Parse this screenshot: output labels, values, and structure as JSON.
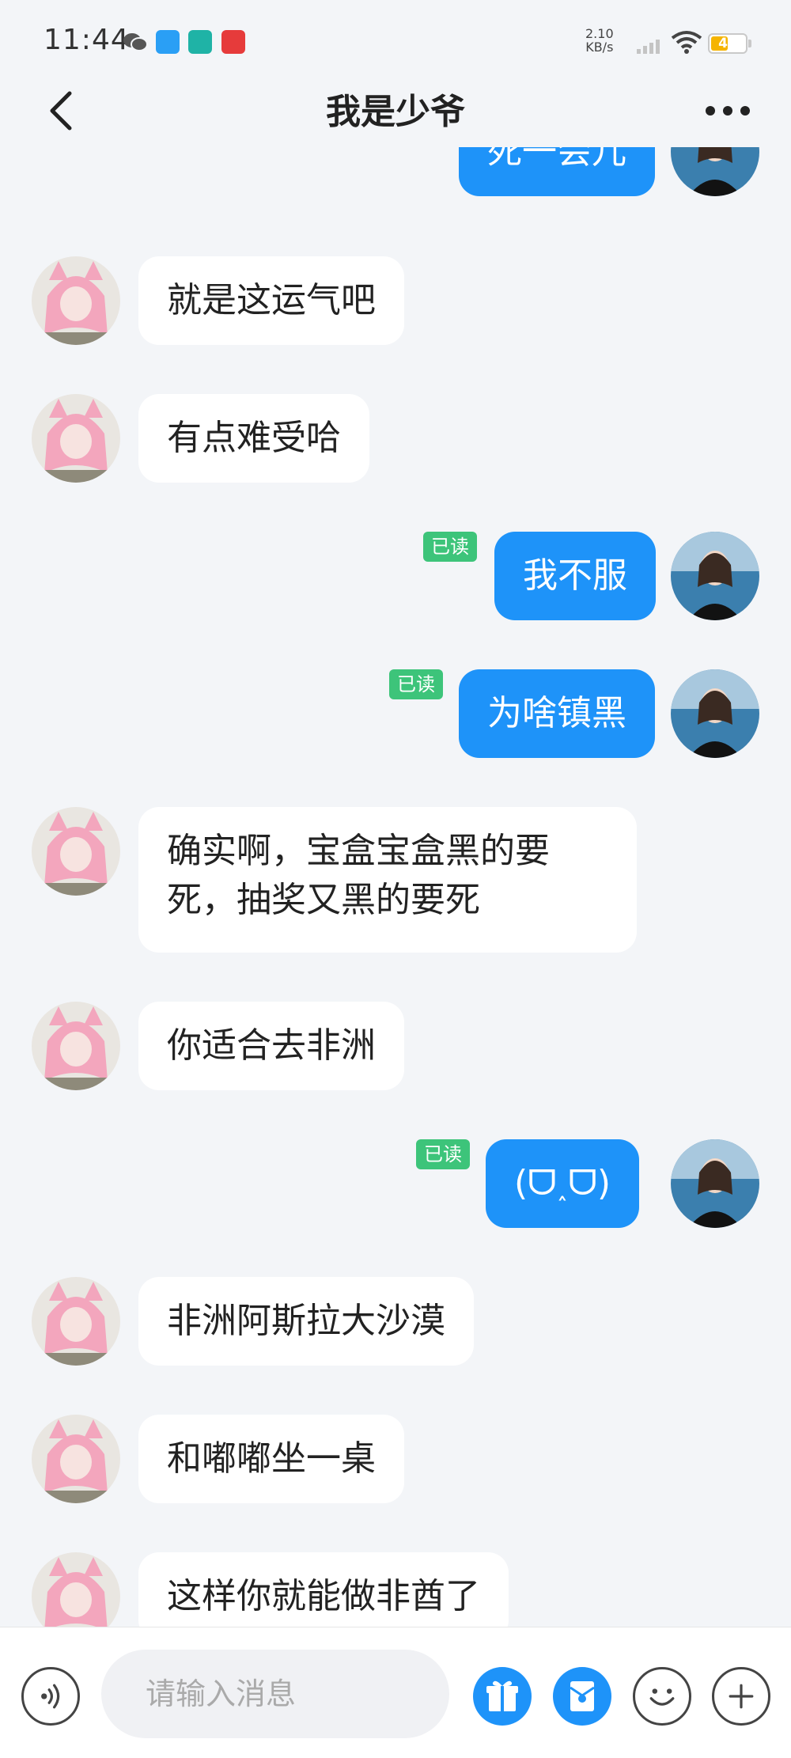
{
  "status_bar": {
    "time": "11:44",
    "net_speed_value": "2.10",
    "net_speed_unit": "KB/s",
    "battery_percent": 49,
    "battery_color": "#f5b400",
    "icons": [
      "wechat-icon",
      "app-blue-icon",
      "boss-app-icon",
      "red-app-icon",
      "signal-icon",
      "wifi-icon",
      "battery-icon"
    ]
  },
  "header": {
    "title": "我是少爷",
    "back_icon": "chevron-left-icon",
    "more_icon": "more-dots-icon"
  },
  "messages": [
    {
      "side": "out",
      "text": "死一会儿",
      "read": ""
    },
    {
      "side": "in",
      "text": "就是这运气吧"
    },
    {
      "side": "in",
      "text": "有点难受哈"
    },
    {
      "side": "out",
      "text": "我不服",
      "read": "已读"
    },
    {
      "side": "out",
      "text": "为啥镇黑",
      "read": "已读"
    },
    {
      "side": "in",
      "text_line1": "确实啊，宝盒宝盒黑的要",
      "text_line2": "死，抽奖又黑的要死"
    },
    {
      "side": "in",
      "text": "你适合去非洲"
    },
    {
      "side": "out",
      "text": "(ᗜ˰ᗜ)",
      "read": "已读"
    },
    {
      "side": "in",
      "text": "非洲阿斯拉大沙漠"
    },
    {
      "side": "in",
      "text": "和嘟嘟坐一桌"
    },
    {
      "side": "in",
      "text": "这样你就能做非酋了"
    }
  ],
  "input_bar": {
    "placeholder": "请输入消息",
    "buttons": [
      "voice-icon",
      "gift-icon",
      "red-packet-icon",
      "emoji-icon",
      "plus-icon"
    ]
  },
  "colors": {
    "accent": "#1e93f9",
    "read_badge": "#3dc47a",
    "background": "#f3f5f8"
  }
}
